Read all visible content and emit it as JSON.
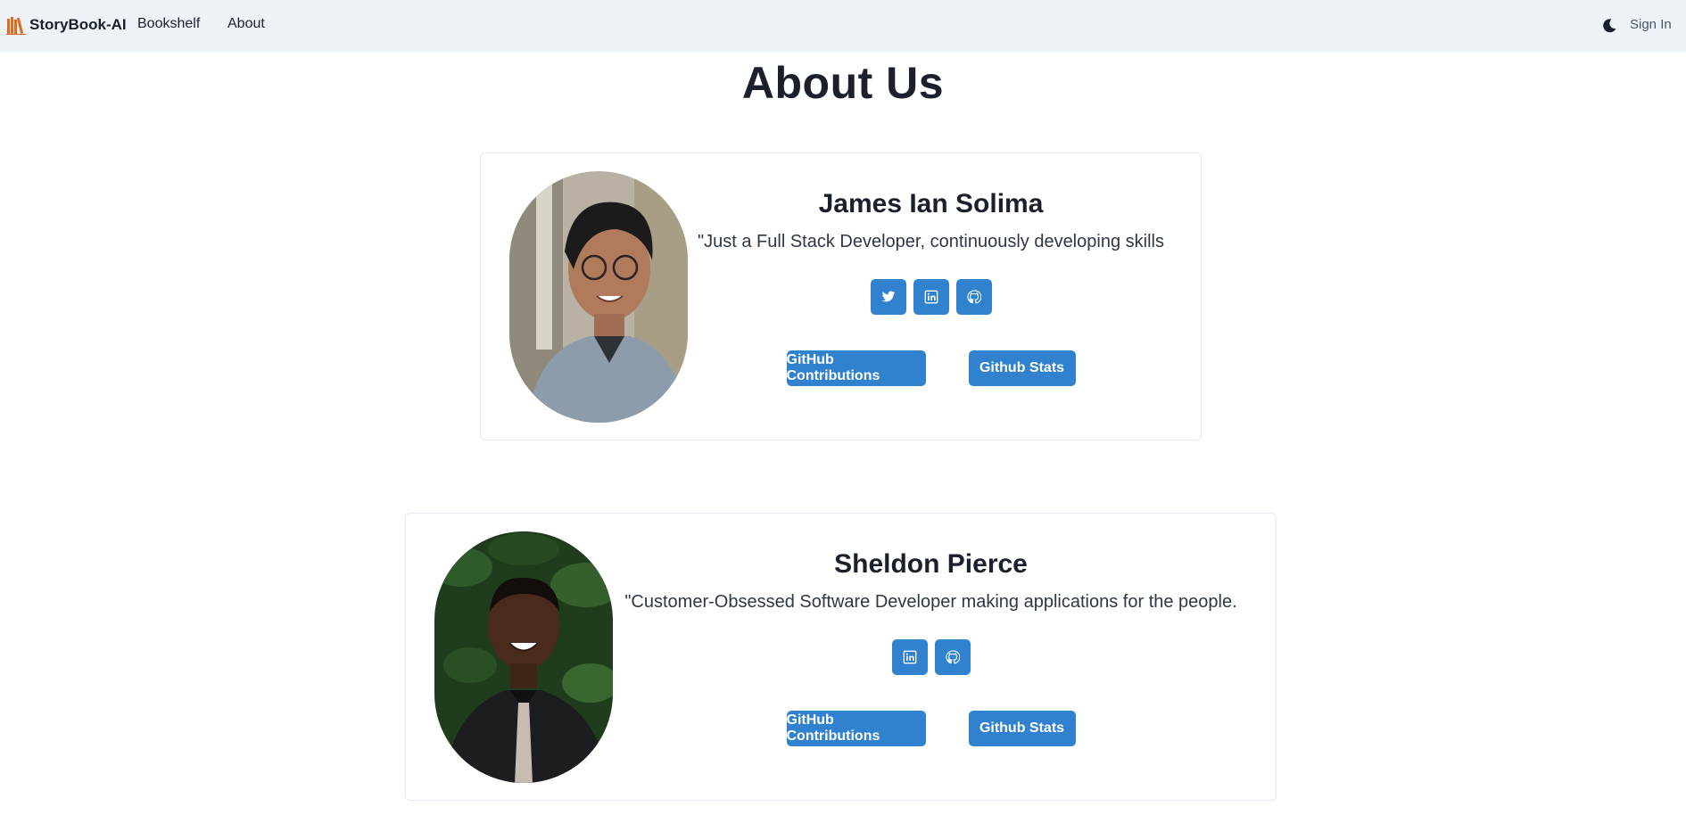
{
  "nav": {
    "brand": "StoryBook-AI",
    "links": [
      "Bookshelf",
      "About"
    ],
    "signin": "Sign In",
    "theme_icon": "moon-icon"
  },
  "page": {
    "title": "About Us"
  },
  "members": [
    {
      "name": "James Ian Solima",
      "bio": "\"Just a Full Stack Developer, continuously developing skills",
      "socials": [
        "twitter-icon",
        "linkedin-icon",
        "github-icon"
      ],
      "buttons": [
        "GitHub Contributions",
        "Github Stats"
      ]
    },
    {
      "name": "Sheldon Pierce",
      "bio": "\"Customer-Obsessed Software Developer making applications for the people.",
      "socials": [
        "linkedin-icon",
        "github-icon"
      ],
      "buttons": [
        "GitHub Contributions",
        "Github Stats"
      ]
    }
  ],
  "colors": {
    "accent": "#3182ce",
    "navbar_bg": "#edf2f7",
    "text": "#1a202c",
    "logo": "#dd6b20"
  }
}
